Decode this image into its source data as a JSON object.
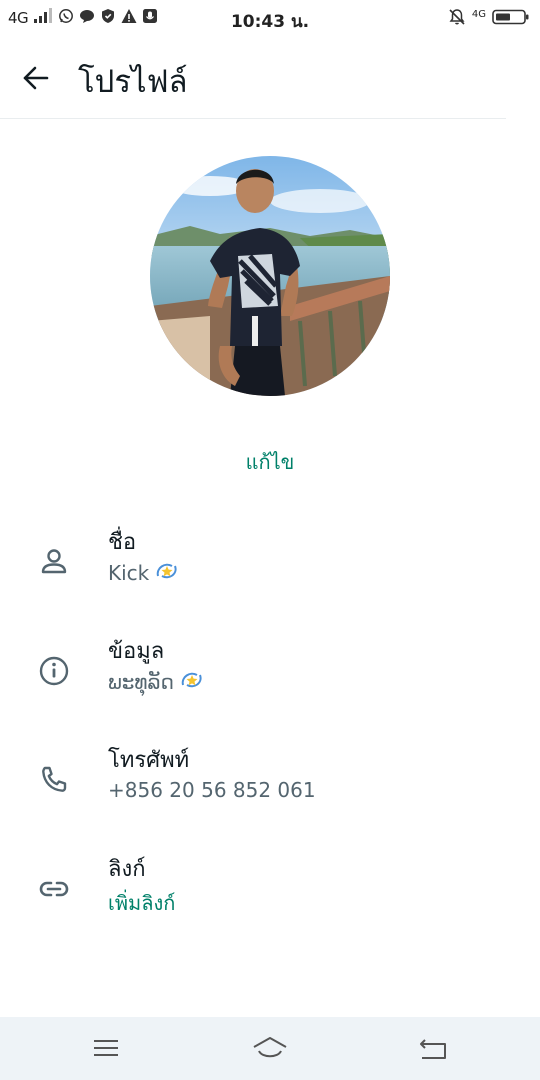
{
  "status_bar": {
    "network": "4G",
    "time": "10:43 น.",
    "right_network": "4G",
    "icons_left": [
      "signal-icon",
      "whatsapp-icon",
      "message-icon",
      "shield-icon",
      "warning-icon",
      "mic-icon"
    ],
    "icons_right": [
      "bell-off-icon",
      "battery-icon"
    ]
  },
  "header": {
    "title": "โปรไฟล์",
    "back_icon": "arrow-left-icon"
  },
  "profile": {
    "edit_label": "แก้ไข"
  },
  "rows": {
    "name": {
      "label": "ชื่อ",
      "value": "Kick",
      "icon": "person-icon",
      "has_emoji": true
    },
    "about": {
      "label": "ข้อมูล",
      "value": "ພະທຸລັດ",
      "icon": "info-icon",
      "has_emoji": true
    },
    "phone": {
      "label": "โทรศัพท์",
      "value": "+856 20 56 852 061",
      "icon": "phone-icon"
    },
    "links": {
      "label": "ลิงก์",
      "value": "เพิ่มลิงก์",
      "icon": "link-icon"
    }
  },
  "nav": {
    "menu_icon": "menu-icon",
    "home_icon": "home-icon",
    "back_icon": "back-icon"
  },
  "colors": {
    "accent": "#008069",
    "text_primary": "#111b21",
    "text_secondary": "#54656f",
    "nav_bg": "#eef3f7"
  }
}
